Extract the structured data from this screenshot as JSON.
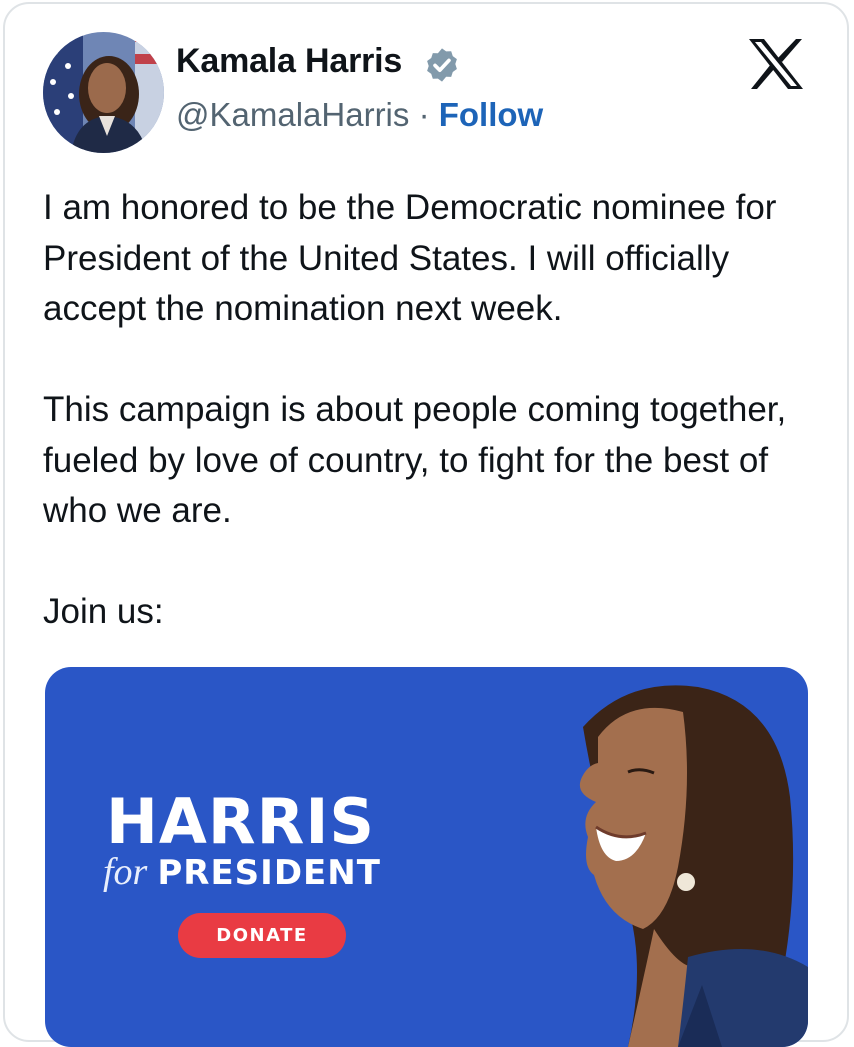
{
  "tweet": {
    "author_name": "Kamala Harris",
    "handle": "@KamalaHarris",
    "separator": "·",
    "follow_label": "Follow",
    "paragraphs": [
      "I am honored to be the Democratic nominee for President of the United States. I will officially accept the nomination next week.",
      "This campaign is about people coming together, fueled by love of country, to fight for the best of who we are.",
      "Join us:"
    ]
  },
  "media": {
    "headline": "HARRIS",
    "for_word": "for",
    "subhead": "PRESIDENT",
    "donate_label": "DONATE"
  },
  "icons": {
    "verified": "verified-badge-icon",
    "platform": "x-logo-icon"
  },
  "colors": {
    "follow_link": "#1d64b8",
    "banner_background": "#2a56c6",
    "donate_button": "#e93b43",
    "verified_badge": "#829aab"
  }
}
